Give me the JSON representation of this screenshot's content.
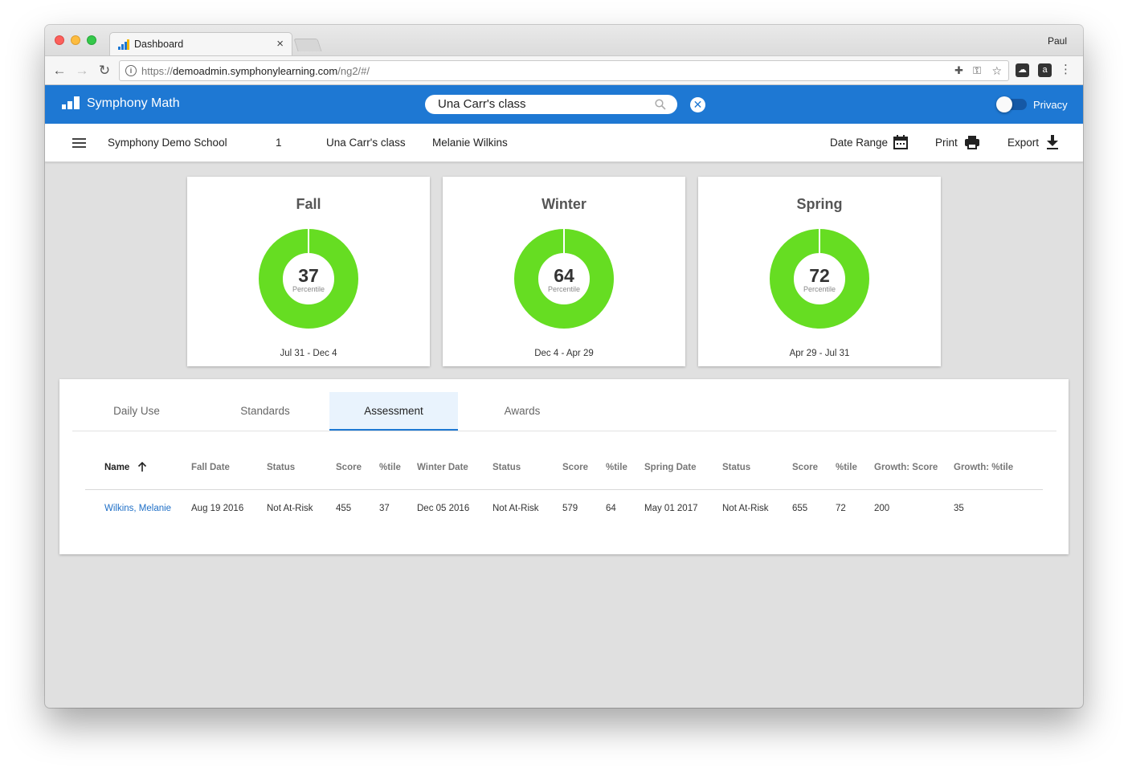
{
  "browser": {
    "tab_title": "Dashboard",
    "tab_close": "×",
    "profile_name": "Paul",
    "url_prefix": "https://",
    "url_host": "demoadmin.symphonylearning.com",
    "url_path": "/ng2/#/"
  },
  "app": {
    "title": "Symphony Math",
    "search_value": "Una Carr's class",
    "clear_glyph": "✕",
    "privacy_label": "Privacy",
    "brand_color": "#1e78d3"
  },
  "breadcrumb": {
    "items": [
      "Symphony Demo School",
      "1",
      "Una Carr's class",
      "Melanie Wilkins"
    ],
    "actions": {
      "date_range": "Date Range",
      "print": "Print",
      "export": "Export"
    }
  },
  "cards": [
    {
      "title": "Fall",
      "value": "37",
      "unit": "Percentile",
      "range": "Jul 31 - Dec 4",
      "fill_percent": 100
    },
    {
      "title": "Winter",
      "value": "64",
      "unit": "Percentile",
      "range": "Dec 4 - Apr 29",
      "fill_percent": 100
    },
    {
      "title": "Spring",
      "value": "72",
      "unit": "Percentile",
      "range": "Apr 29 - Jul 31",
      "fill_percent": 100
    }
  ],
  "ring_color": "#66dd22",
  "tabs": [
    {
      "label": "Daily Use",
      "active": false
    },
    {
      "label": "Standards",
      "active": false
    },
    {
      "label": "Assessment",
      "active": true
    },
    {
      "label": "Awards",
      "active": false
    }
  ],
  "table": {
    "headers": [
      "Name",
      "Fall Date",
      "Status",
      "Score",
      "%tile",
      "Winter Date",
      "Status",
      "Score",
      "%tile",
      "Spring Date",
      "Status",
      "Score",
      "%tile",
      "Growth: Score",
      "Growth: %tile"
    ],
    "sort_icon": "arrow-up-icon",
    "rows": [
      [
        "Wilkins, Melanie",
        "Aug 19 2016",
        "Not At-Risk",
        "455",
        "37",
        "Dec 05 2016",
        "Not At-Risk",
        "579",
        "64",
        "May 01 2017",
        "Not At-Risk",
        "655",
        "72",
        "200",
        "35"
      ]
    ]
  }
}
